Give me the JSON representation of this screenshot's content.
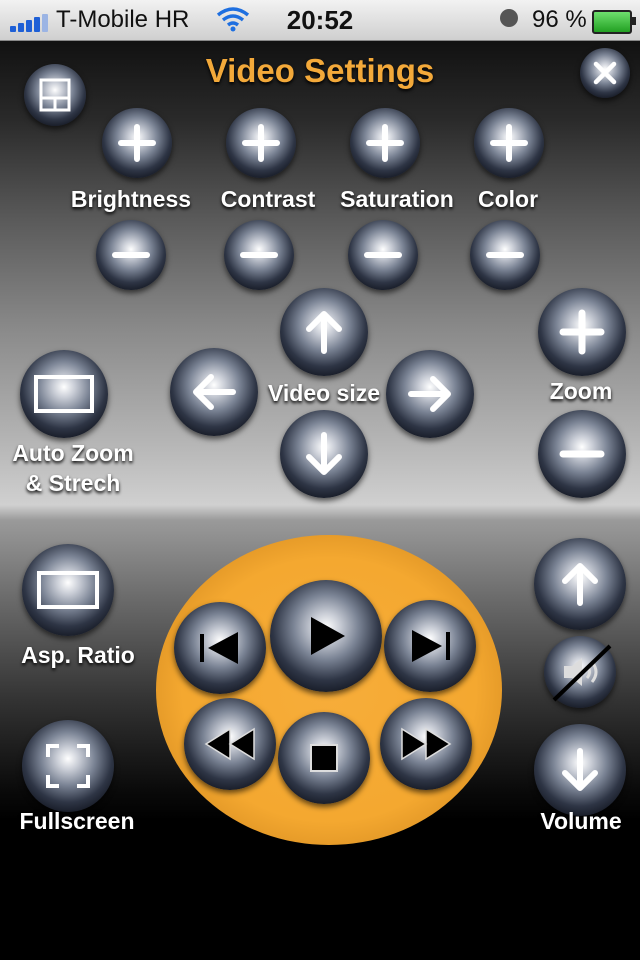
{
  "status_bar": {
    "carrier": "T-Mobile HR",
    "time": "20:52",
    "battery_percent": "96 %"
  },
  "header": {
    "title": "Video Settings",
    "layout_icon": "layout-grid-icon",
    "close_icon": "close-icon"
  },
  "picture": {
    "brightness_label": "Brightness",
    "contrast_label": "Contrast",
    "saturation_label": "Saturation",
    "color_label": "Color"
  },
  "video": {
    "size_label": "Video size",
    "zoom_label": "Zoom",
    "auto_zoom_label_line1": "Auto Zoom",
    "auto_zoom_label_line2": "& Strech",
    "aspect_ratio_label": "Asp. Ratio",
    "fullscreen_label": "Fullscreen",
    "volume_label": "Volume"
  },
  "colors": {
    "accent": "#f3a93a",
    "disc": "#f4a830"
  }
}
